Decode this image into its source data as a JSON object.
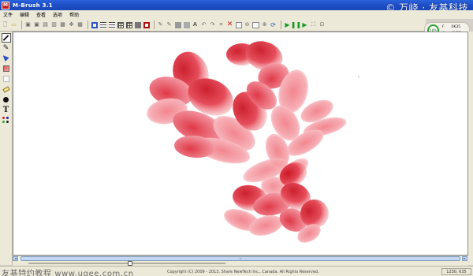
{
  "window": {
    "title": "M-Brush 3.1",
    "app_icon_text": "M"
  },
  "watermark_top": "© 万峣 · 友基科技",
  "menu": [
    "文件",
    "编辑",
    "查看",
    "选项",
    "帮助"
  ],
  "toolbar_icons": [
    "new-icon",
    "open-icon",
    "save-icon",
    "save-as-icon",
    "print-icon",
    "export-icon",
    "import-icon",
    "move-icon",
    "grid-icon",
    "frame-icon",
    "lines-icon",
    "list-icon",
    "layers-icon",
    "table-icon",
    "dark-box-icon",
    "red-frame-icon",
    "brush-a-icon",
    "brush-b-icon",
    "stamp-icon",
    "smudge-icon",
    "text-icon",
    "undo-icon",
    "redo-icon",
    "crop-icon",
    "delete-icon",
    "blank-icon",
    "zoom-out-icon",
    "rect-icon",
    "zoom-in-icon",
    "rotate-icon",
    "play-icon",
    "pause-icon",
    "step-icon",
    "fullscreen-icon",
    "fit-icon"
  ],
  "memory": {
    "percent": "58%",
    "rows": [
      {
        "label": "F",
        "value": "0K35"
      },
      {
        "label": "A",
        "value": "0K35"
      }
    ]
  },
  "palette_tools": [
    "brush-tool-icon",
    "pen-tool-icon",
    "fill-tool-icon",
    "swatch-tool-icon",
    "blank-tool-icon",
    "eraser-tool-icon",
    "ink-tool-icon",
    "text-tool-icon",
    "color-tool-icon"
  ],
  "scroll": {
    "left_arrow": "◄",
    "right_arrow": "►",
    "grip": "≡"
  },
  "statusbar": {
    "watermark": "友基特约教程  www.ugee.com.cn",
    "copyright": "Copyright (C) 2009 - 2013, Share NewTech Inc., Canada.  All Rights Reserved.",
    "coords": "1230, 635"
  },
  "colors": {
    "titlebar": "#1f4fc7",
    "chrome": "#ece9d8",
    "petal_dark": "#c8101f",
    "petal_light": "#f4a0a6"
  }
}
